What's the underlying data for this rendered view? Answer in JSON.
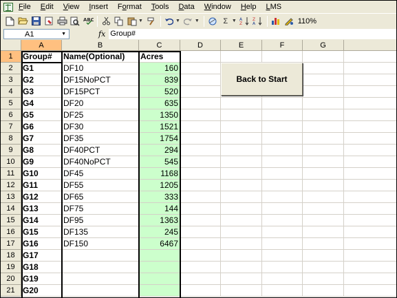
{
  "menu": [
    "File",
    "Edit",
    "View",
    "Insert",
    "Format",
    "Tools",
    "Data",
    "Window",
    "Help",
    "LMS"
  ],
  "menu_accel": [
    "F",
    "E",
    "V",
    "I",
    "o",
    "T",
    "D",
    "W",
    "H",
    "L"
  ],
  "toolbar": {
    "zoom": "110%"
  },
  "formula_bar": {
    "cell_ref": "A1",
    "fx": "fx",
    "content": "Group#"
  },
  "columns": [
    "A",
    "B",
    "C",
    "D",
    "E",
    "F",
    "G"
  ],
  "rows": [
    "1",
    "2",
    "3",
    "4",
    "5",
    "6",
    "7",
    "8",
    "9",
    "10",
    "11",
    "12",
    "13",
    "14",
    "15",
    "16",
    "17",
    "18",
    "19",
    "20",
    "21"
  ],
  "headers": {
    "a": "Group#",
    "b": "Name(Optional)",
    "c": "Acres"
  },
  "table": [
    {
      "group": "G1",
      "name": "DF10",
      "acres": "160"
    },
    {
      "group": "G2",
      "name": "DF15NoPCT",
      "acres": "839"
    },
    {
      "group": "G3",
      "name": "DF15PCT",
      "acres": "520"
    },
    {
      "group": "G4",
      "name": "DF20",
      "acres": "635"
    },
    {
      "group": "G5",
      "name": "DF25",
      "acres": "1350"
    },
    {
      "group": "G6",
      "name": "DF30",
      "acres": "1521"
    },
    {
      "group": "G7",
      "name": "DF35",
      "acres": "1754"
    },
    {
      "group": "G8",
      "name": "DF40PCT",
      "acres": "294"
    },
    {
      "group": "G9",
      "name": "DF40NoPCT",
      "acres": "545"
    },
    {
      "group": "G10",
      "name": "DF45",
      "acres": "1168"
    },
    {
      "group": "G11",
      "name": "DF55",
      "acres": "1205"
    },
    {
      "group": "G12",
      "name": "DF65",
      "acres": "333"
    },
    {
      "group": "G13",
      "name": "DF75",
      "acres": "144"
    },
    {
      "group": "G14",
      "name": "DF95",
      "acres": "1363"
    },
    {
      "group": "G15",
      "name": "DF135",
      "acres": "245"
    },
    {
      "group": "G16",
      "name": "DF150",
      "acres": "6467"
    },
    {
      "group": "G17",
      "name": "",
      "acres": ""
    },
    {
      "group": "G18",
      "name": "",
      "acres": ""
    },
    {
      "group": "G19",
      "name": "",
      "acres": ""
    },
    {
      "group": "G20",
      "name": "",
      "acres": ""
    }
  ],
  "button": {
    "label": "Back to Start"
  },
  "colors": {
    "acres_fill": "#ccffcc",
    "header_selected": "#ffc080"
  }
}
